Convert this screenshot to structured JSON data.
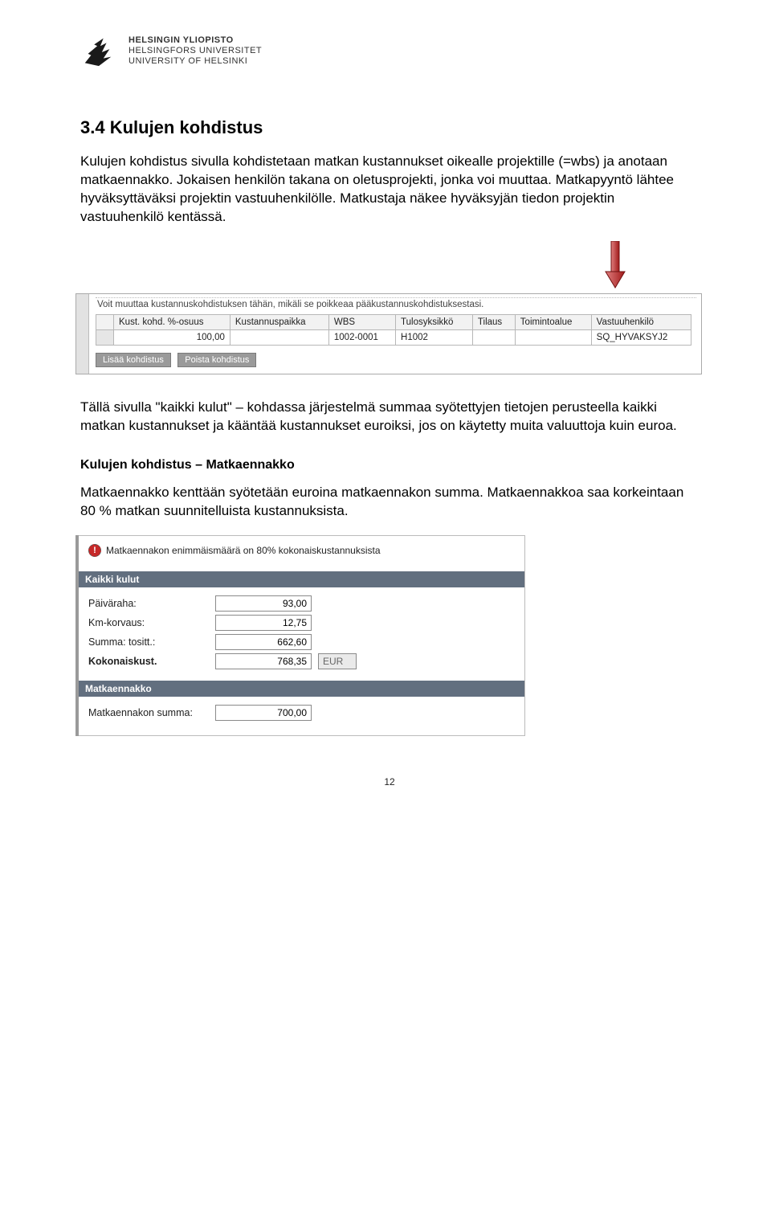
{
  "header": {
    "uni_fi": "HELSINGIN YLIOPISTO",
    "uni_sv": "HELSINGFORS UNIVERSITET",
    "uni_en": "UNIVERSITY OF HELSINKI"
  },
  "section": {
    "title": "3.4 Kulujen kohdistus",
    "p1": "Kulujen kohdistus sivulla kohdistetaan matkan kustannukset oikealle projektille (=wbs) ja anotaan matkaennakko. Jokaisen henkilön takana on oletusprojekti, jonka voi muuttaa. Matkapyyntö lähtee hyväksyttäväksi projektin vastuuhenkilölle. Matkustaja näkee hyväksyjän tiedon projektin vastuuhenkilö kentässä.",
    "p2": "Tällä sivulla \"kaikki kulut\" – kohdassa järjestelmä summaa syötettyjen tietojen perusteella kaikki matkan kustannukset ja kääntää kustannukset euroiksi, jos on käytetty muita valuuttoja kuin euroa.",
    "sub_heading": "Kulujen kohdistus – Matkaennakko",
    "p3": "Matkaennakko kenttään syötetään euroina matkaennakon summa. Matkaennakkoa saa korkeintaan 80 % matkan suunnitelluista kustannuksista."
  },
  "screenshot1": {
    "partial_header_text": "Voit muuttaa kustannuskohdistuksen tähän, mikäli se poikkeaa pääkustannuskohdistuksestasi.",
    "columns": [
      "Kust. kohd. %-osuus",
      "Kustannuspaikka",
      "WBS",
      "Tulosyksikkö",
      "Tilaus",
      "Toimintoalue",
      "Vastuuhenkilö"
    ],
    "row": {
      "pct": "100,00",
      "kustannuspaikka": "",
      "wbs": "1002-0001",
      "tulosyksikko": "H1002",
      "tilaus": "",
      "toimintoalue": "",
      "vastuuhenkilo": "SQ_HYVAKSYJ2"
    },
    "btn_add": "Lisää kohdistus",
    "btn_remove": "Poista kohdistus"
  },
  "screenshot2": {
    "warning": "Matkaennakon enimmäismäärä on 80% kokonaiskustannuksista",
    "panel1_title": "Kaikki kulut",
    "rows": [
      {
        "label": "Päiväraha:",
        "value": "93,00"
      },
      {
        "label": "Km-korvaus:",
        "value": "12,75"
      },
      {
        "label": "Summa: tositt.:",
        "value": "662,60"
      }
    ],
    "total_label": "Kokonaiskust.",
    "total_value": "768,35",
    "currency": "EUR",
    "panel2_title": "Matkaennakko",
    "advance_label": "Matkaennakon summa:",
    "advance_value": "700,00"
  },
  "page_number": "12"
}
